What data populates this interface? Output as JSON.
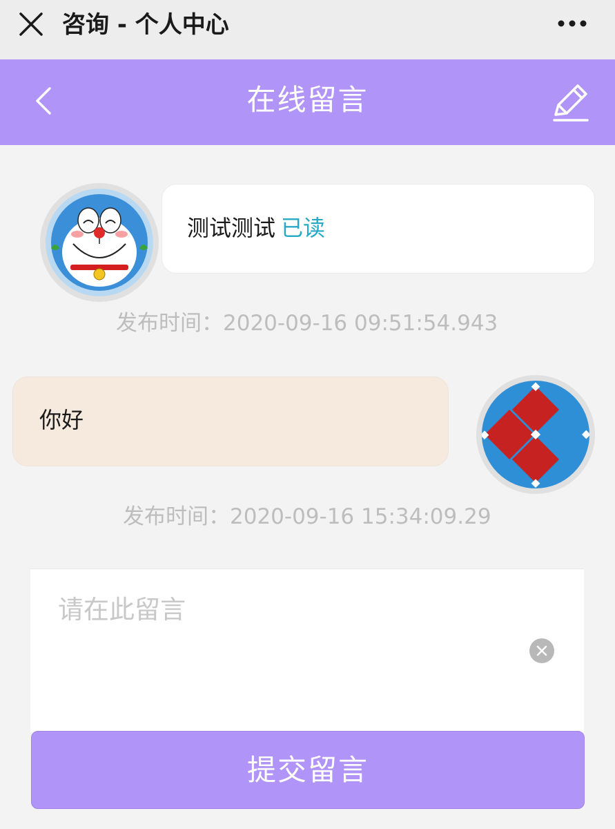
{
  "topbar": {
    "title": "咨询 - 个人中心",
    "close_icon": "close-icon",
    "more_icon": "more-dots-icon"
  },
  "header": {
    "title": "在线留言",
    "back_icon": "chevron-left-icon",
    "edit_icon": "pencil-icon",
    "color": "#b194f7"
  },
  "messages": [
    {
      "side": "left",
      "text": "测试测试",
      "status": "已读",
      "timestamp": "发布时间：2020-09-16 09:51:54.943",
      "avatar": "cartoon-cat-avatar",
      "bubble_color": "#ffffff"
    },
    {
      "side": "right",
      "text": "你好",
      "timestamp": "发布时间：2020-09-16 15:34:09.29",
      "avatar": "red-blue-logo-avatar",
      "bubble_color": "#f6eadf"
    }
  ],
  "compose": {
    "placeholder": "请在此留言",
    "value": "",
    "clear_icon": "clear-circle-icon",
    "submit_label": "提交留言"
  }
}
